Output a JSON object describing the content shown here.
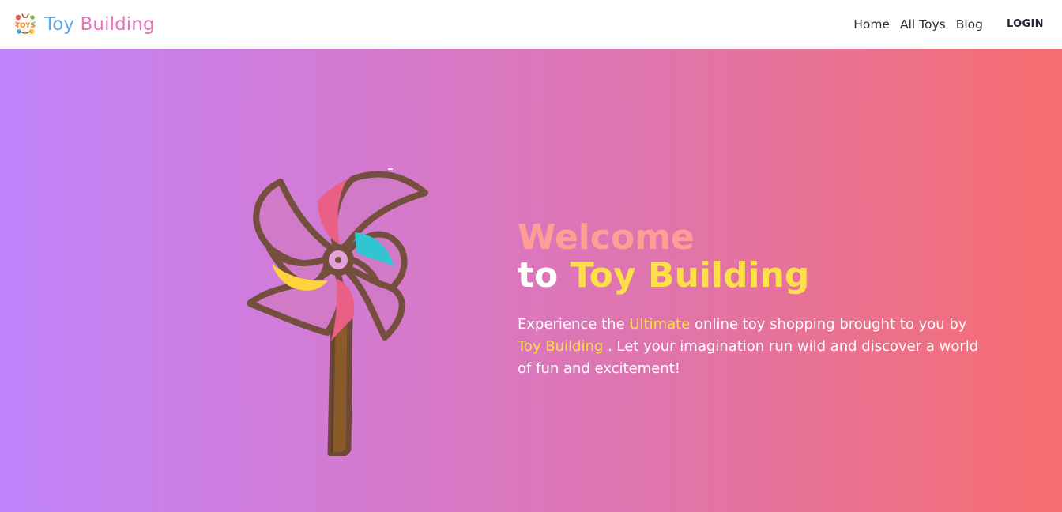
{
  "header": {
    "brand": {
      "logo_icon": "toys-logo-icon",
      "logo_text": "TOYS",
      "word1": "Toy",
      "word2": "Building",
      "colors": {
        "word1": "#63a6e6",
        "word2": "#e774b5"
      }
    },
    "nav": [
      {
        "label": "Home"
      },
      {
        "label": "All Toys"
      },
      {
        "label": "Blog"
      }
    ],
    "login_label": "LOGIN"
  },
  "hero": {
    "background_gradient": [
      "#c084fc",
      "#d47ad0",
      "#e174a8",
      "#f76d6f"
    ],
    "title_line1": "Welcome",
    "title_line2_prefix": "to",
    "title_line2_brand": "Toy Building",
    "description_part1": "Experience the ",
    "description_highlight1": "Ultimate",
    "description_part2": " online toy shopping brought to you by ",
    "description_highlight2": "Toy Building",
    "description_part3": ". Let your imagination run wild and discover a world of fun and excitement!",
    "illustration_icon": "pinwheel-icon",
    "colors": {
      "welcome": "#ff9e95",
      "accent": "#fde047",
      "text": "#ffffff"
    }
  }
}
